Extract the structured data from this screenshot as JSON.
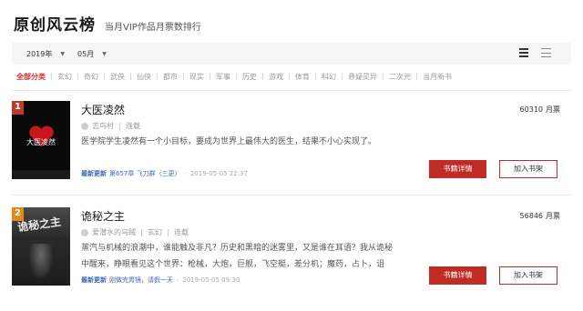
{
  "header": {
    "title": "原创风云榜",
    "subtitle": "当月VIP作品月票数排行"
  },
  "filters": {
    "year": "2019年",
    "month": "05月"
  },
  "categories": [
    "全部分类",
    "玄幻",
    "奇幻",
    "武侠",
    "仙侠",
    "都市",
    "现实",
    "军事",
    "历史",
    "游戏",
    "体育",
    "科幻",
    "悬疑灵异",
    "二次元",
    "当月新书"
  ],
  "active_category": "全部分类",
  "books": [
    {
      "rank": "1",
      "cover_text": "大医凌然",
      "title": "大医凌然",
      "author": "志鸟村",
      "genre": "",
      "status": "连载",
      "description": "医学院学生凌然有一个小目标，要成为世界上最伟大的医生，结果不小心实现了。",
      "update_label": "最新更新",
      "update_chapter": "第657章 飞刀群（三更）",
      "update_time": "2019-05-05 22:37",
      "votes": "60310",
      "votes_unit": "月票",
      "detail_button": "书籍详情",
      "shelf_button": "加入书架"
    },
    {
      "rank": "2",
      "cover_text": "诡秘之主",
      "title": "诡秘之主",
      "author": "爱潜水的乌贼",
      "genre": "玄幻",
      "status": "连载",
      "description": "蒸汽与机械的浪潮中，谁能触及非凡？历史和黑暗的迷雾里，又是谁在耳语？我从诡秘中醒来，睁眼看见这个世界：枪械，大炮，巨舰，飞空艇，差分机；魔药，占卜，诅",
      "update_label": "最新更新",
      "update_chapter": "刚做完胃镜，请假一天",
      "update_time": "2019-05-05 09:30",
      "votes": "56846",
      "votes_unit": "月票",
      "detail_button": "书籍详情",
      "shelf_button": "加入书架"
    }
  ]
}
